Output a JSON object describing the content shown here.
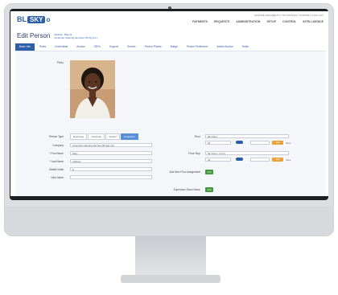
{
  "app": {
    "logo_text": "BL",
    "logo_box": "SKY",
    "logo_suffix": "o",
    "utility_links": "CHANGE AVAILABILITY | MY PROFILE | SUPPORT | LOG OUT",
    "nav": [
      "PAYMENTS",
      "REQUESTS",
      "ADMINISTRATION",
      "SETUP",
      "CONTROL",
      "INTELLIGENCE"
    ]
  },
  "page": {
    "title": "Edit Person",
    "subtitle_line1": "Addison, Mary E.",
    "subtitle_line2": "American Catering Services (55 Agt Inc)"
  },
  "tabs": [
    {
      "label": "Basic Info",
      "active": true
    },
    {
      "label": "Roles"
    },
    {
      "label": "Credentials"
    },
    {
      "label": "Access"
    },
    {
      "label": "ODFs"
    },
    {
      "label": "Support"
    },
    {
      "label": "Service"
    },
    {
      "label": "Person Photos"
    },
    {
      "label": "Badge"
    },
    {
      "label": "Person Preference"
    },
    {
      "label": "Added Access"
    },
    {
      "label": "Notes"
    }
  ],
  "form": {
    "photo_label": "Photo",
    "person_type_label": "Person Type",
    "person_types": [
      "Employee",
      "Customer",
      "Vendor",
      "Contractor"
    ],
    "person_type_selected": "Contractor",
    "company_label": "Company",
    "company_value": "American Catering Service (55 Agt Inc)",
    "first_name_label": "* First Name",
    "first_name_value": "Mary",
    "last_name_label": "* Last Name",
    "last_name_value": "Addison",
    "middle_label": "Middle Initial",
    "middle_value": "E",
    "nick_label": "Nick Name",
    "floor_label": "Floor",
    "floor_value": "6th Floor",
    "floor_stop_label": "Floor Stop",
    "floor_stop_value": "6th Floor - Front",
    "add_assign_label": "Add New Floor Assignment",
    "add_btn": "Add",
    "supervisor_label": "Supervisor Show Name",
    "sup_btn": "Add",
    "orange_btn1": "Add",
    "orange_btn2": "Add",
    "save_text": "Save",
    "all_text": "All"
  },
  "colors": {
    "accent": "#2d5ea8",
    "active_seg": "#5b8fd6",
    "green": "#3d9b3d",
    "orange": "#e8a23a"
  }
}
